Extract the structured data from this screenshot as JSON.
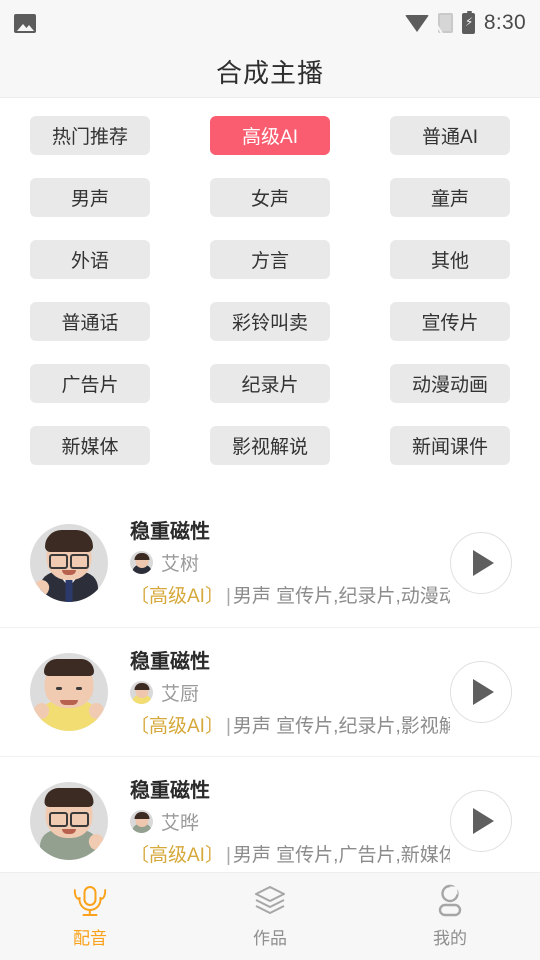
{
  "statusbar": {
    "time": "8:30",
    "icons": [
      "image-icon",
      "wifi-icon",
      "sim-card-off-icon",
      "battery-charging-icon"
    ]
  },
  "header": {
    "title": "合成主播"
  },
  "colors": {
    "accent_active_tag": "#fb5d70",
    "tag_background": "#e9e9e9",
    "nav_active": "#faa21b",
    "meta_tag": "#d6a83a",
    "header_background": "#f7f7f7"
  },
  "tags": [
    {
      "label": "热门推荐",
      "active": false
    },
    {
      "label": "高级AI",
      "active": true
    },
    {
      "label": "普通AI",
      "active": false
    },
    {
      "label": "男声",
      "active": false
    },
    {
      "label": "女声",
      "active": false
    },
    {
      "label": "童声",
      "active": false
    },
    {
      "label": "外语",
      "active": false
    },
    {
      "label": "方言",
      "active": false
    },
    {
      "label": "其他",
      "active": false
    },
    {
      "label": "普通话",
      "active": false
    },
    {
      "label": "彩铃叫卖",
      "active": false
    },
    {
      "label": "宣传片",
      "active": false
    },
    {
      "label": "广告片",
      "active": false
    },
    {
      "label": "纪录片",
      "active": false
    },
    {
      "label": "动漫动画",
      "active": false
    },
    {
      "label": "新媒体",
      "active": false
    },
    {
      "label": "影视解说",
      "active": false
    },
    {
      "label": "新闻课件",
      "active": false
    }
  ],
  "voices": [
    {
      "title": "稳重磁性",
      "author": "艾树",
      "tag": "〔高级AI〕",
      "separator": "|",
      "meta": "男声 宣传片,纪录片,动漫动画…",
      "play": "play-button"
    },
    {
      "title": "稳重磁性",
      "author": "艾厨",
      "tag": "〔高级AI〕",
      "separator": "|",
      "meta": "男声 宣传片,纪录片,影视解说",
      "play": "play-button"
    },
    {
      "title": "稳重磁性",
      "author": "艾晔",
      "tag": "〔高级AI〕",
      "separator": "|",
      "meta": "男声 宣传片,广告片,新媒体",
      "play": "play-button"
    }
  ],
  "tabbar": [
    {
      "label": "配音",
      "icon": "microphone-icon",
      "active": true
    },
    {
      "label": "作品",
      "icon": "layers-icon",
      "active": false
    },
    {
      "label": "我的",
      "icon": "person-icon",
      "active": false
    }
  ]
}
